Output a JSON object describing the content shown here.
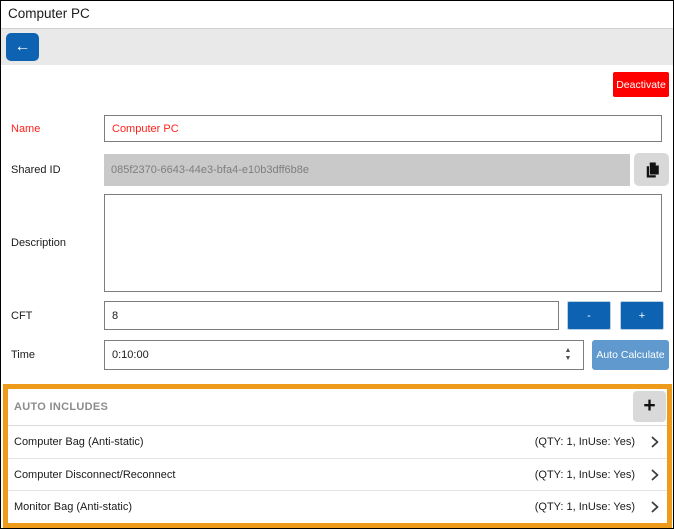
{
  "window": {
    "title": "Computer PC"
  },
  "toolbar": {
    "back_icon": "←"
  },
  "header": {
    "deactivate_label": "Deactivate"
  },
  "form": {
    "name": {
      "label": "Name",
      "value": "Computer PC"
    },
    "shared_id": {
      "label": "Shared ID",
      "value": "085f2370-6643-44e3-bfa4-e10b3dff6b8e"
    },
    "description": {
      "label": "Description",
      "value": ""
    },
    "cft": {
      "label": "CFT",
      "value": "8",
      "decrement_label": "-",
      "increment_label": "+"
    },
    "time": {
      "label": "Time",
      "value": "0:10:00",
      "spinner_up_icon": "▲",
      "spinner_down_icon": "▼",
      "auto_calculate_label": "Auto Calculate"
    }
  },
  "auto_includes": {
    "header": "AUTO INCLUDES",
    "add_button_label": "+",
    "items": [
      {
        "name": "Computer Bag (Anti-static)",
        "meta": "(QTY: 1, InUse: Yes)"
      },
      {
        "name": "Computer Disconnect/Reconnect",
        "meta": "(QTY: 1, InUse: Yes)"
      },
      {
        "name": "Monitor Bag (Anti-static)",
        "meta": "(QTY: 1, InUse: Yes)"
      }
    ]
  },
  "colors": {
    "accent_blue": "#0D62B1",
    "muted_blue": "#5F99CD",
    "danger_red": "#FF0000",
    "highlight_orange": "#EE9B1C",
    "name_text_red": "#FF221C"
  }
}
